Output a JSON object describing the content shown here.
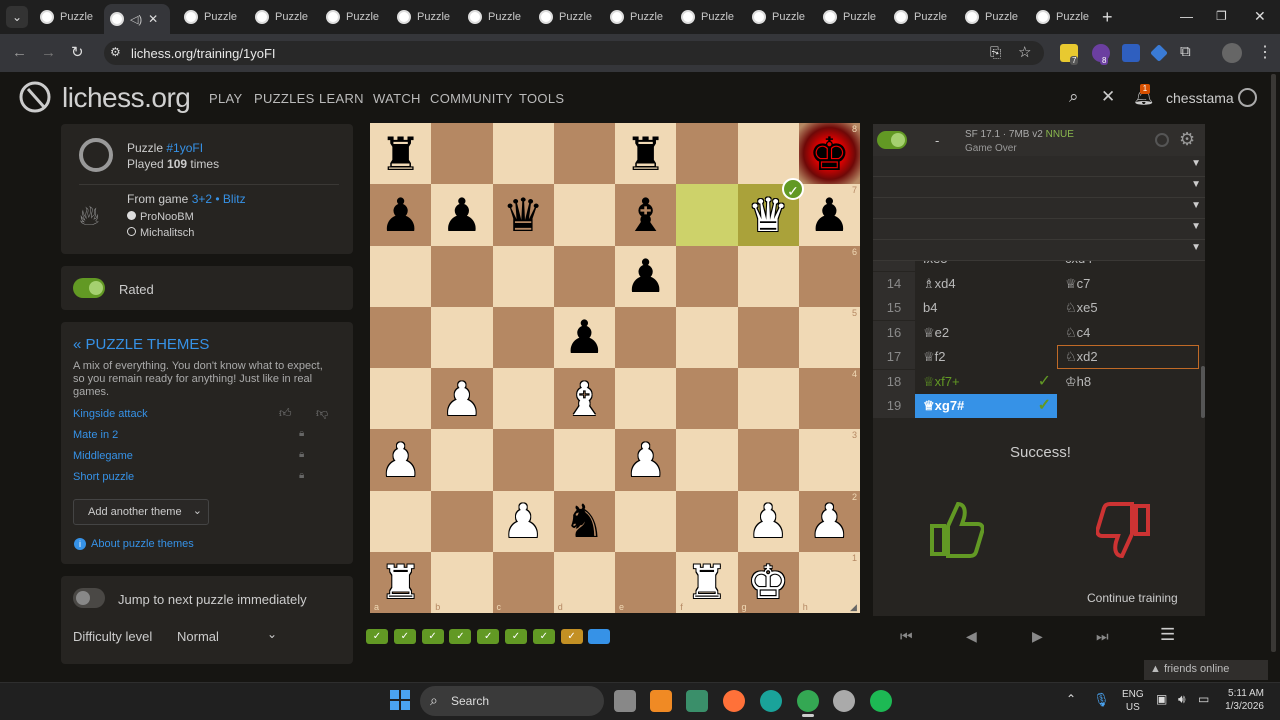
{
  "browser": {
    "tabs": [
      "Puzzle",
      "",
      "Puzzle",
      "Puzzle",
      "Puzzle",
      "Puzzle",
      "Puzzle",
      "Puzzle",
      "Puzzle",
      "Puzzle",
      "Puzzle",
      "Puzzle",
      "Puzzle",
      "Puzzle",
      "Puzzle"
    ],
    "url": "lichess.org/training/1yoFI",
    "new_tab": "+",
    "ext_badges": {
      "purple": "8",
      "yellow": "7"
    }
  },
  "header": {
    "logo": "lichess.org",
    "nav": [
      "PLAY",
      "PUZZLES",
      "LEARN",
      "WATCH",
      "COMMUNITY",
      "TOOLS"
    ],
    "username": "chesstama",
    "notif_count": "1"
  },
  "puzzle_info": {
    "puzzle_label": "Puzzle",
    "puzzle_id": "#1yoFI",
    "played_prefix": "Played",
    "played_count": "109",
    "played_suffix": "times",
    "from_game_label": "From game",
    "game_type": "3+2 • Blitz",
    "white_player": "ProNooBM",
    "black_player": "Michalitsch"
  },
  "rated": {
    "label": "Rated"
  },
  "themes": {
    "title": "« PUZZLE THEMES",
    "desc": "A mix of everything. You don't know what to expect, so you remain ready for anything! Just like in real games.",
    "items": [
      "Kingside attack",
      "Mate in 2",
      "Middlegame",
      "Short puzzle"
    ],
    "add_another": "Add another theme",
    "about": "About puzzle themes"
  },
  "settings": {
    "jump_next": "Jump to next puzzle immediately",
    "difficulty_label": "Difficulty level",
    "difficulty_value": "Normal"
  },
  "board": {
    "ranks": [
      "8",
      "7",
      "6",
      "5",
      "4",
      "3",
      "2",
      "1"
    ],
    "files": [
      "a",
      "b",
      "c",
      "d",
      "e",
      "f",
      "g",
      "h"
    ],
    "position": [
      [
        "br",
        "",
        "",
        "",
        "br",
        "",
        "",
        "bk"
      ],
      [
        "bp",
        "bp",
        "bq",
        "",
        "bb",
        "",
        "wq",
        "bp"
      ],
      [
        "",
        "",
        "",
        "",
        "bp",
        "",
        "",
        ""
      ],
      [
        "",
        "",
        "",
        "bp",
        "",
        "",
        "",
        ""
      ],
      [
        "",
        "wp",
        "",
        "wb",
        "",
        "",
        "",
        ""
      ],
      [
        "wp",
        "",
        "",
        "",
        "wp",
        "",
        "",
        ""
      ],
      [
        "",
        "",
        "wp",
        "bn",
        "",
        "",
        "wp",
        "wp"
      ],
      [
        "wr",
        "",
        "",
        "",
        "",
        "wr",
        "wk",
        ""
      ]
    ],
    "highlight_last": [
      "f7",
      "g7"
    ],
    "check_square": "h8"
  },
  "engine": {
    "name": "SF 17.1 · 7MB v2",
    "nnue": "NNUE",
    "status": "Game Over",
    "eval": "-"
  },
  "moves": [
    {
      "n": "",
      "w": "fxe5",
      "b": "cxd4"
    },
    {
      "n": "14",
      "w": "♗xd4",
      "b": "♕c7"
    },
    {
      "n": "15",
      "w": "b4",
      "b": "♘xe5"
    },
    {
      "n": "16",
      "w": "♕e2",
      "b": "♘c4"
    },
    {
      "n": "17",
      "w": "♕f2",
      "b": "♘xd2"
    },
    {
      "n": "18",
      "w": "♕xf7+",
      "b": "♔h8"
    },
    {
      "n": "19",
      "w": "♕xg7#",
      "b": ""
    }
  ],
  "result": {
    "success": "Success!",
    "continue": "Continue training"
  },
  "streak": [
    "✓",
    "✓",
    "✓",
    "✓",
    "✓",
    "✓",
    "✓",
    "✓",
    ""
  ],
  "friends": "▲ friends online",
  "taskbar": {
    "search": "Search",
    "lang": "ENG",
    "region": "US",
    "time": "5:11 AM",
    "date": "1/3/2026"
  },
  "colors": {
    "green": "#629924",
    "blue": "#3692e7",
    "check": "#ff0000"
  }
}
